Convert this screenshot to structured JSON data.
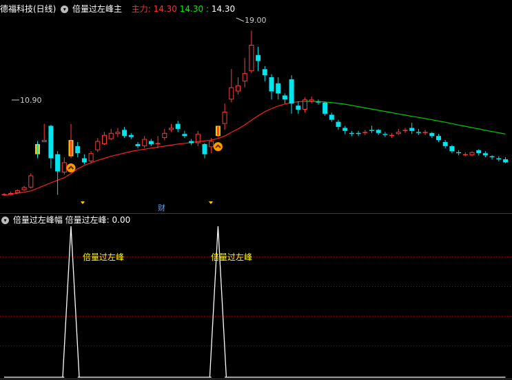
{
  "top_header": {
    "stock_name": "德福科技(日线)",
    "indicator_name": "倍量过左峰主",
    "main_label": "主力:",
    "main_red": "14.30",
    "main_green": "14.30",
    "main_white": "14.30"
  },
  "bottom_header": {
    "indicator_name": "倍量过左峰幅",
    "value_label": "倍量过左峰: 0.00"
  },
  "colors": {
    "background": "#000000",
    "up": "#ff3b3b",
    "down": "#00e5ee",
    "ma_up": "#ff2020",
    "ma_down": "#00cc00",
    "signal": "#ffcc00",
    "panel_line": "#cc0000",
    "grid": "#aa0000"
  },
  "chart_data": [
    {
      "type": "candlestick",
      "title": "德福科技(日线)",
      "annotations": [
        {
          "text": "10.90",
          "type": "low"
        },
        {
          "text": "19.00",
          "type": "high"
        },
        {
          "text": "财",
          "type": "event-marker"
        }
      ],
      "ylim": [
        10.3,
        19.9
      ],
      "candles": [
        [
          10.92,
          10.93,
          10.99,
          10.86
        ],
        [
          10.9,
          10.98,
          11.06,
          10.88
        ],
        [
          10.98,
          11.12,
          11.18,
          10.95
        ],
        [
          11.13,
          11.27,
          11.34,
          11.08
        ],
        [
          11.26,
          11.85,
          11.96,
          11.2
        ],
        [
          13.4,
          12.9,
          13.55,
          12.7
        ],
        [
          13.5,
          13.6,
          14.4,
          13.5
        ],
        [
          14.3,
          12.7,
          14.35,
          12.2
        ],
        [
          12.9,
          12.05,
          13.05,
          10.9
        ],
        [
          12.0,
          12.5,
          12.75,
          11.9
        ],
        [
          12.8,
          13.6,
          14.4,
          12.7
        ],
        [
          13.3,
          12.95,
          13.5,
          12.75
        ],
        [
          12.7,
          12.5,
          12.9,
          12.4
        ],
        [
          12.55,
          12.95,
          13.05,
          12.45
        ],
        [
          13.1,
          13.55,
          13.7,
          13.0
        ],
        [
          13.4,
          13.85,
          14.0,
          13.35
        ],
        [
          13.65,
          13.95,
          14.15,
          13.6
        ],
        [
          13.9,
          14.0,
          14.2,
          13.75
        ],
        [
          14.1,
          13.8,
          14.25,
          13.7
        ],
        [
          13.85,
          13.75,
          13.95,
          13.65
        ],
        [
          13.4,
          13.3,
          13.5,
          13.2
        ],
        [
          13.3,
          13.65,
          13.8,
          13.2
        ],
        [
          13.55,
          13.4,
          13.65,
          13.3
        ],
        [
          13.4,
          13.45,
          13.8,
          13.2
        ],
        [
          13.7,
          13.95,
          14.15,
          13.6
        ],
        [
          14.1,
          14.2,
          14.4,
          14.0
        ],
        [
          14.4,
          14.15,
          14.55,
          14.0
        ],
        [
          13.9,
          13.8,
          14.05,
          13.7
        ],
        [
          13.55,
          13.45,
          13.65,
          13.35
        ],
        [
          13.45,
          13.9,
          14.05,
          13.3
        ],
        [
          13.4,
          12.9,
          13.45,
          12.7
        ],
        [
          13.25,
          13.55,
          13.7,
          12.95
        ],
        [
          13.8,
          14.3,
          14.3,
          13.75
        ],
        [
          14.4,
          15.0,
          15.4,
          14.1
        ],
        [
          15.6,
          16.2,
          17.1,
          15.45
        ],
        [
          16.0,
          16.3,
          16.7,
          15.85
        ],
        [
          16.5,
          16.9,
          17.65,
          16.2
        ],
        [
          17.0,
          18.3,
          19.0,
          16.9
        ],
        [
          17.8,
          17.5,
          18.2,
          17.0
        ],
        [
          17.1,
          16.8,
          17.25,
          16.5
        ],
        [
          16.7,
          16.0,
          16.85,
          15.6
        ],
        [
          16.4,
          15.9,
          16.7,
          15.6
        ],
        [
          15.8,
          15.6,
          15.9,
          15.4
        ],
        [
          16.6,
          15.4,
          16.8,
          14.9
        ],
        [
          15.3,
          15.1,
          15.5,
          14.9
        ],
        [
          15.1,
          15.6,
          15.7,
          14.95
        ],
        [
          15.5,
          15.6,
          15.75,
          15.4
        ],
        [
          15.5,
          15.45,
          15.6,
          15.35
        ],
        [
          15.45,
          14.9,
          15.5,
          14.8
        ],
        [
          14.85,
          14.6,
          14.95,
          14.5
        ],
        [
          14.5,
          14.25,
          14.6,
          14.1
        ],
        [
          14.2,
          14.05,
          14.3,
          13.9
        ],
        [
          13.95,
          13.9,
          14.05,
          13.8
        ],
        [
          13.95,
          13.9,
          14.05,
          13.8
        ],
        [
          13.95,
          14.0,
          14.1,
          13.85
        ],
        [
          14.1,
          14.05,
          14.3,
          13.95
        ],
        [
          14.1,
          13.95,
          14.15,
          13.85
        ],
        [
          13.9,
          13.85,
          14.0,
          13.75
        ],
        [
          13.8,
          13.85,
          13.95,
          13.7
        ],
        [
          13.9,
          14.0,
          14.15,
          13.85
        ],
        [
          14.05,
          14.1,
          14.2,
          13.95
        ],
        [
          14.2,
          14.05,
          14.45,
          13.9
        ],
        [
          14.0,
          13.95,
          14.15,
          13.85
        ],
        [
          13.95,
          14.0,
          14.1,
          13.85
        ],
        [
          13.95,
          13.8,
          14.0,
          13.7
        ],
        [
          13.8,
          13.6,
          13.9,
          13.5
        ],
        [
          13.5,
          13.3,
          13.6,
          13.2
        ],
        [
          13.3,
          13.05,
          13.35,
          12.95
        ],
        [
          13.0,
          12.95,
          13.1,
          12.85
        ],
        [
          12.85,
          12.9,
          13.0,
          12.8
        ],
        [
          12.85,
          13.0,
          13.05,
          12.8
        ],
        [
          13.1,
          12.95,
          13.15,
          12.85
        ],
        [
          12.95,
          12.85,
          13.05,
          12.75
        ],
        [
          12.8,
          12.75,
          12.85,
          12.65
        ],
        [
          12.7,
          12.65,
          12.8,
          12.55
        ],
        [
          12.65,
          12.5,
          12.75,
          12.45
        ]
      ],
      "signal_candles": [
        5,
        10,
        32
      ],
      "ma": [
        10.87,
        10.92,
        10.98,
        11.03,
        11.09,
        11.22,
        11.36,
        11.49,
        11.62,
        11.74,
        11.95,
        12.18,
        12.35,
        12.48,
        12.6,
        12.7,
        12.8,
        12.88,
        12.96,
        13.04,
        13.1,
        13.15,
        13.2,
        13.25,
        13.3,
        13.35,
        13.4,
        13.44,
        13.48,
        13.52,
        13.56,
        13.6,
        13.68,
        13.8,
        13.98,
        14.15,
        14.35,
        14.58,
        14.8,
        15.0,
        15.15,
        15.28,
        15.38,
        15.45,
        15.49,
        15.51,
        15.51,
        15.5,
        15.48,
        15.45,
        15.41,
        15.37,
        15.31,
        15.25,
        15.19,
        15.13,
        15.07,
        15.01,
        14.95,
        14.89,
        14.83,
        14.77,
        14.72,
        14.66,
        14.6,
        14.54,
        14.48,
        14.41,
        14.34,
        14.28,
        14.21,
        14.15,
        14.08,
        14.02,
        13.96,
        13.9
      ]
    },
    {
      "type": "line",
      "title": "倍量过左峰",
      "annotations": [
        {
          "text": "倍量过左峰",
          "at": 10
        },
        {
          "text": "倍量过左峰",
          "at": 32
        }
      ],
      "ylim": [
        0,
        1
      ],
      "values": [
        0,
        0,
        0,
        0,
        0,
        0,
        0,
        0,
        0,
        0,
        1,
        0,
        0,
        0,
        0,
        0,
        0,
        0,
        0,
        0,
        0,
        0,
        0,
        0,
        0,
        0,
        0,
        0,
        0,
        0,
        0,
        0,
        1,
        0,
        0,
        0,
        0,
        0,
        0,
        0,
        0,
        0,
        0,
        0,
        0,
        0,
        0,
        0,
        0,
        0,
        0,
        0,
        0,
        0,
        0,
        0,
        0,
        0,
        0,
        0,
        0,
        0,
        0,
        0,
        0,
        0,
        0,
        0,
        0,
        0,
        0,
        0,
        0,
        0,
        0,
        0
      ]
    }
  ]
}
